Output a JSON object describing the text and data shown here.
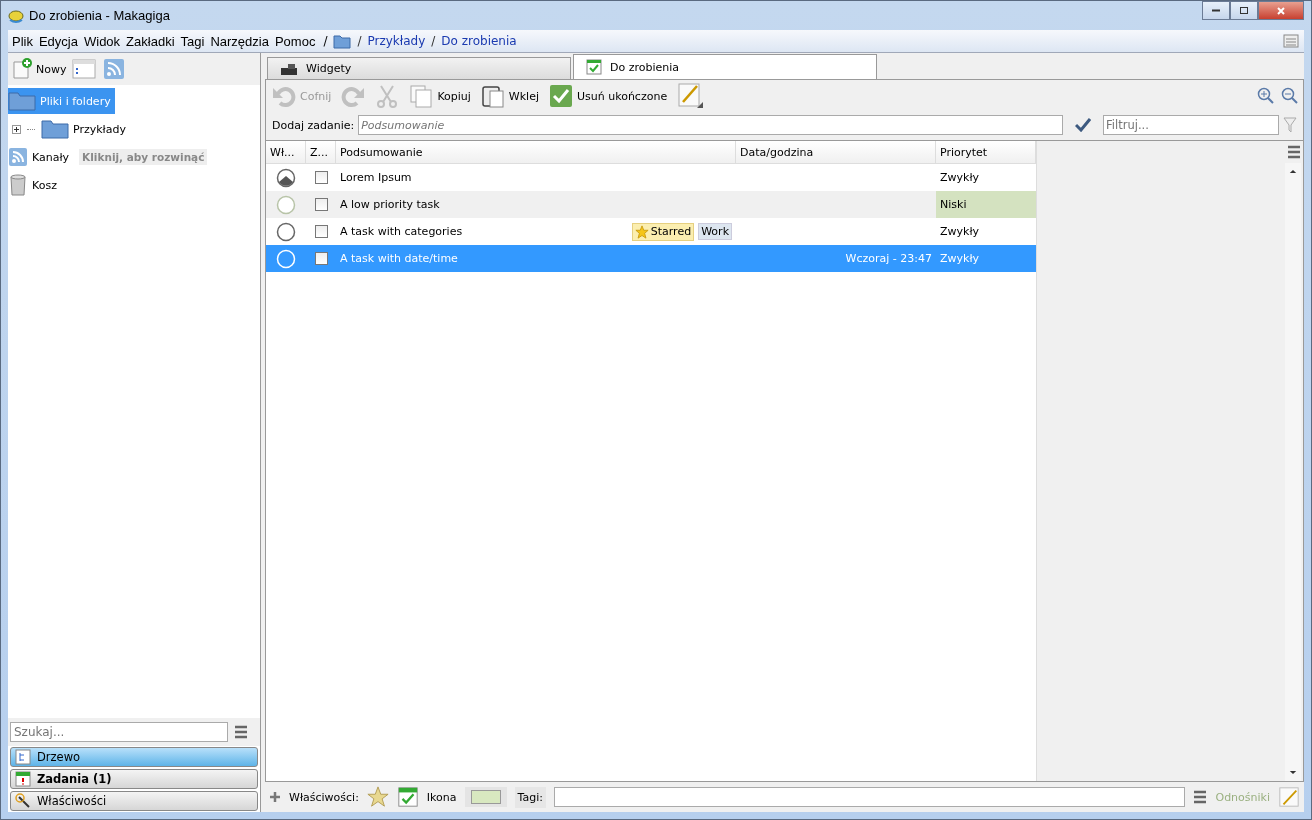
{
  "window": {
    "title": "Do zrobienia - Makagiga"
  },
  "menu": [
    "Plik",
    "Edycja",
    "Widok",
    "Zakładki",
    "Tagi",
    "Narzędzia",
    "Pomoc"
  ],
  "path_root": "/",
  "breadcrumb": [
    {
      "separator": "/",
      "label": "Przykłady"
    },
    {
      "separator": "/",
      "label": "Do zrobienia"
    }
  ],
  "left_toolbar": {
    "new_label": "Nowy"
  },
  "tree": [
    {
      "label": "Pliki i foldery",
      "selected": true,
      "children": [
        {
          "label": "Przykłady",
          "selected": false,
          "expanded": false
        }
      ]
    },
    {
      "label": "Kanały",
      "selected": false,
      "hint": "Kliknij, aby rozwinąć"
    },
    {
      "label": "Kosz",
      "selected": false
    }
  ],
  "search": {
    "placeholder": "Szukaj..."
  },
  "panels": [
    {
      "label": "Drzewo",
      "selected": true,
      "bold": false
    },
    {
      "label": "Zadania (1)",
      "selected": false,
      "bold": true
    },
    {
      "label": "Właściwości",
      "selected": false,
      "bold": false
    }
  ],
  "tabs": [
    {
      "label": "Widgety",
      "selected": false
    },
    {
      "label": "Do zrobienia",
      "selected": true
    }
  ],
  "toolbar": [
    {
      "kind": "undo",
      "label": "Cofnij",
      "disabled": true
    },
    {
      "kind": "redo",
      "disabled": true
    },
    {
      "kind": "cut",
      "disabled": true
    },
    {
      "kind": "copy",
      "label": "Kopiuj",
      "disabled": false
    },
    {
      "kind": "paste",
      "label": "Wklej",
      "disabled": false
    },
    {
      "kind": "check",
      "label": "Usuń ukończone",
      "disabled": false
    },
    {
      "kind": "edit",
      "disabled": false
    }
  ],
  "add_task": {
    "label": "Dodaj zadanie:",
    "placeholder": "Podsumowanie"
  },
  "filter": {
    "placeholder": "Filtruj..."
  },
  "columns": [
    "Wł...",
    "Z...",
    "Podsumowanie",
    "Data/godzina",
    "Priorytet"
  ],
  "rows": [
    {
      "started": true,
      "low_priority": false,
      "checked": false,
      "summary": "Lorem Ipsum",
      "priority": "Zwykły",
      "selected": false
    },
    {
      "started": false,
      "low_priority": true,
      "checked": false,
      "summary": "A low priority task",
      "priority": "Niski",
      "selected": false
    },
    {
      "started": false,
      "low_priority": false,
      "checked": false,
      "summary": "A task with categories",
      "tags": [
        {
          "label": "Starred",
          "kind": "star"
        },
        {
          "label": "Work",
          "kind": "plain"
        }
      ],
      "priority": "Zwykły",
      "selected": false
    },
    {
      "started": false,
      "low_priority": false,
      "checked": false,
      "summary": "A task with date/time",
      "datetime": "Wczoraj - 23:47",
      "priority": "Zwykły",
      "selected": true
    }
  ],
  "bottom": {
    "properties_label": "Właściwości:",
    "icon_label": "Ikona",
    "tags_label": "Tagi:",
    "links_label": "Odnośniki"
  }
}
